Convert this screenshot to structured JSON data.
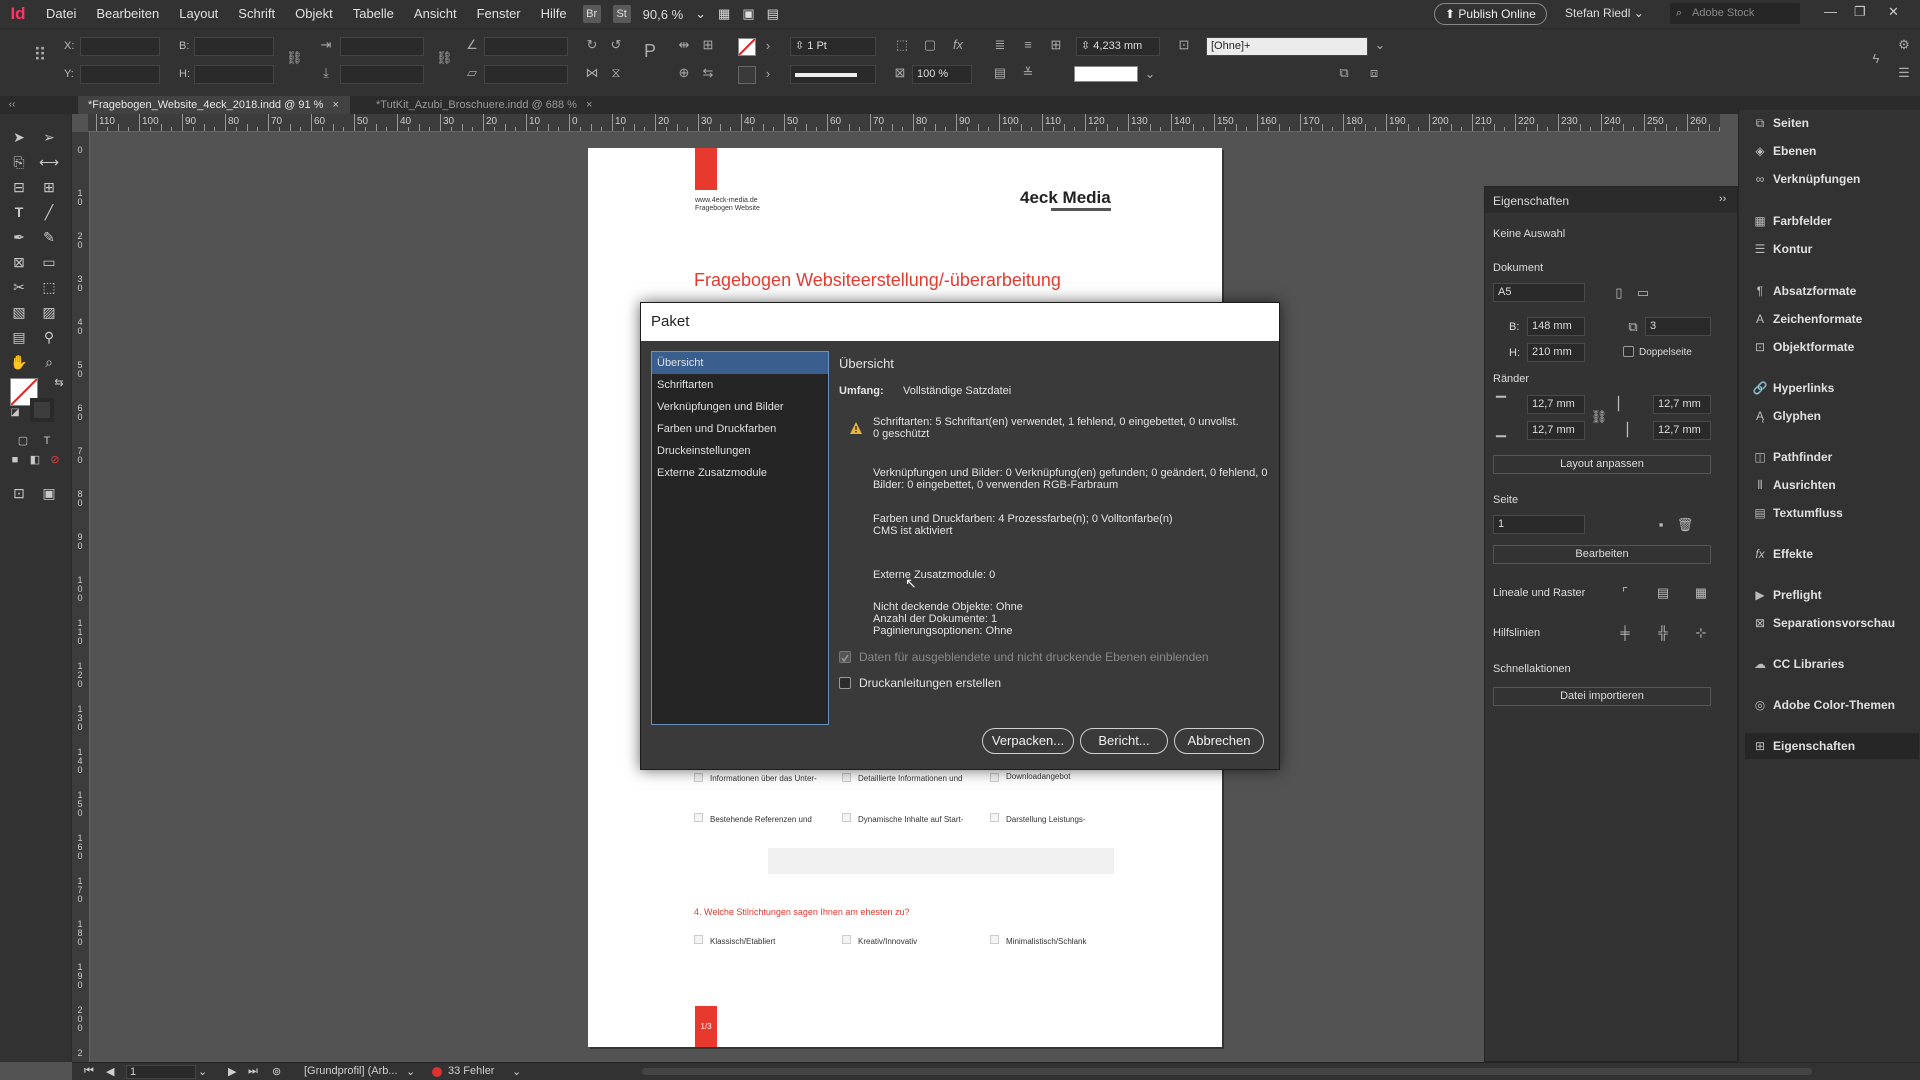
{
  "app": {
    "logo": "Id",
    "menu": [
      "Datei",
      "Bearbeiten",
      "Layout",
      "Schrift",
      "Objekt",
      "Tabelle",
      "Ansicht",
      "Fenster",
      "Hilfe"
    ],
    "bridge_badge": "Br",
    "stock_badge": "St",
    "zoom": "90,6 %",
    "publish_label": "Publish Online",
    "user": "Stefan Riedl",
    "stock_placeholder": "Adobe Stock",
    "accent_color": "#ff3366"
  },
  "controlbar": {
    "x_label": "X:",
    "y_label": "Y:",
    "w_label": "B:",
    "h_label": "H:",
    "stroke_weight": "1 Pt",
    "opacity": "100 %",
    "gap_value": "4,233 mm",
    "object_style": "[Ohne]+"
  },
  "tabs": [
    {
      "label": "*Fragebogen_Website_4eck_2018.indd @ 91 %",
      "close": "×"
    },
    {
      "label": "*TutKit_Azubi_Broschuere.indd @ 688 %",
      "close": "×"
    }
  ],
  "ruler_top": [
    "110",
    "100",
    "90",
    "80",
    "70",
    "60",
    "50",
    "40",
    "30",
    "20",
    "10",
    "0",
    "10",
    "20",
    "30",
    "40",
    "50",
    "60",
    "70",
    "80",
    "90",
    "100",
    "110",
    "120",
    "130",
    "140",
    "150",
    "160",
    "170",
    "180",
    "190",
    "200",
    "210",
    "220",
    "230",
    "240",
    "250",
    "260"
  ],
  "ruler_left": [
    "0",
    "1 0",
    "2 0",
    "3 0",
    "4 0",
    "5 0",
    "6 0",
    "7 0",
    "8 0",
    "9 0",
    "1 0 0",
    "1 1 0",
    "1 2 0",
    "1 3 0",
    "1 4 0",
    "1 5 0",
    "1 6 0",
    "1 7 0",
    "1 8 0",
    "1 9 0",
    "2 0 0",
    "2"
  ],
  "page": {
    "url_line1": "www.4eck-media.de",
    "url_line2": "Fragebogen Website",
    "brand": "4eck Media",
    "heading": "Fragebogen Websiteerstellung/-überarbeitung",
    "brand_red": "#e8392f",
    "options_row1": [
      "Informationen über das Unter-",
      "Detaillierte Informationen und",
      "Downloadangebot"
    ],
    "options_row2": [
      "Bestehende Referenzen und",
      "Dynamische Inhalte auf Start-",
      "Darstellung Leistungs-"
    ],
    "question4": "4. Welche Stilrichtungen sagen Ihnen am ehesten zu?",
    "options_row3": [
      "Klassisch/Etabliert",
      "Kreativ/Innovativ",
      "Minimalistisch/Schlank"
    ],
    "page_badge": "1/3"
  },
  "dialog": {
    "title": "Paket",
    "nav": [
      "Übersicht",
      "Schriftarten",
      "Verknüpfungen und Bilder",
      "Farben und Druckfarben",
      "Druckeinstellungen",
      "Externe Zusatzmodule"
    ],
    "section_title": "Übersicht",
    "scope_label": "Umfang:",
    "scope_value": "Vollständige Satzdatei",
    "fonts_line1": "Schriftarten: 5 Schriftart(en) verwendet, 1 fehlend, 0 eingebettet, 0 unvollst.",
    "fonts_line2": "0 geschützt",
    "links_line1": "Verknüpfungen und Bilder: 0 Verknüpfung(en) gefunden; 0 geändert, 0 fehlend, 0 ...",
    "links_line2": "Bilder: 0 eingebettet, 0 verwenden RGB-Farbraum",
    "colors_line1": "Farben und Druckfarben: 4 Prozessfarbe(n); 0 Volltonfarbe(n)",
    "colors_line2": "CMS ist aktiviert",
    "plugins_line": "Externe Zusatzmodule: 0",
    "misc_line1": "Nicht deckende Objekte:  Ohne",
    "misc_line2": "Anzahl der Dokumente: 1",
    "misc_line3": "Paginierungsoptionen:  Ohne",
    "check_hidden": "Daten für ausgeblendete und nicht druckende Ebenen einblenden",
    "check_instructions": "Druckanleitungen erstellen",
    "btn_package": "Verpacken...",
    "btn_report": "Bericht...",
    "btn_cancel": "Abbrechen"
  },
  "properties": {
    "title": "Eigenschaften",
    "no_selection": "Keine Auswahl",
    "document_label": "Dokument",
    "page_size": "A5",
    "w_label": "B:",
    "w_value": "148 mm",
    "h_label": "H:",
    "h_value": "210 mm",
    "pages_value": "3",
    "facing_label": "Doppelseite",
    "margins_label": "Ränder",
    "margin_top": "12,7 mm",
    "margin_inner": "12,7 mm",
    "margin_bottom": "12,7 mm",
    "margin_outer": "12,7 mm",
    "layout_btn": "Layout anpassen",
    "page_label": "Seite",
    "page_value": "1",
    "edit_btn": "Bearbeiten",
    "rulers_label": "Lineale und Raster",
    "guides_label": "Hilfslinien",
    "quick_label": "Schnellaktionen",
    "import_btn": "Datei importieren"
  },
  "panels": [
    "Seiten",
    "Ebenen",
    "Verknüpfungen",
    "Farbfelder",
    "Kontur",
    "Absatzformate",
    "Zeichenformate",
    "Objektformate",
    "Hyperlinks",
    "Glyphen",
    "Pathfinder",
    "Ausrichten",
    "Textumfluss",
    "Effekte",
    "Preflight",
    "Separationsvorschau",
    "CC Libraries",
    "Adobe Color-Themen",
    "Eigenschaften"
  ],
  "status": {
    "page": "1",
    "profile": "[Grundprofil] (Arb...",
    "errors": "33 Fehler"
  }
}
